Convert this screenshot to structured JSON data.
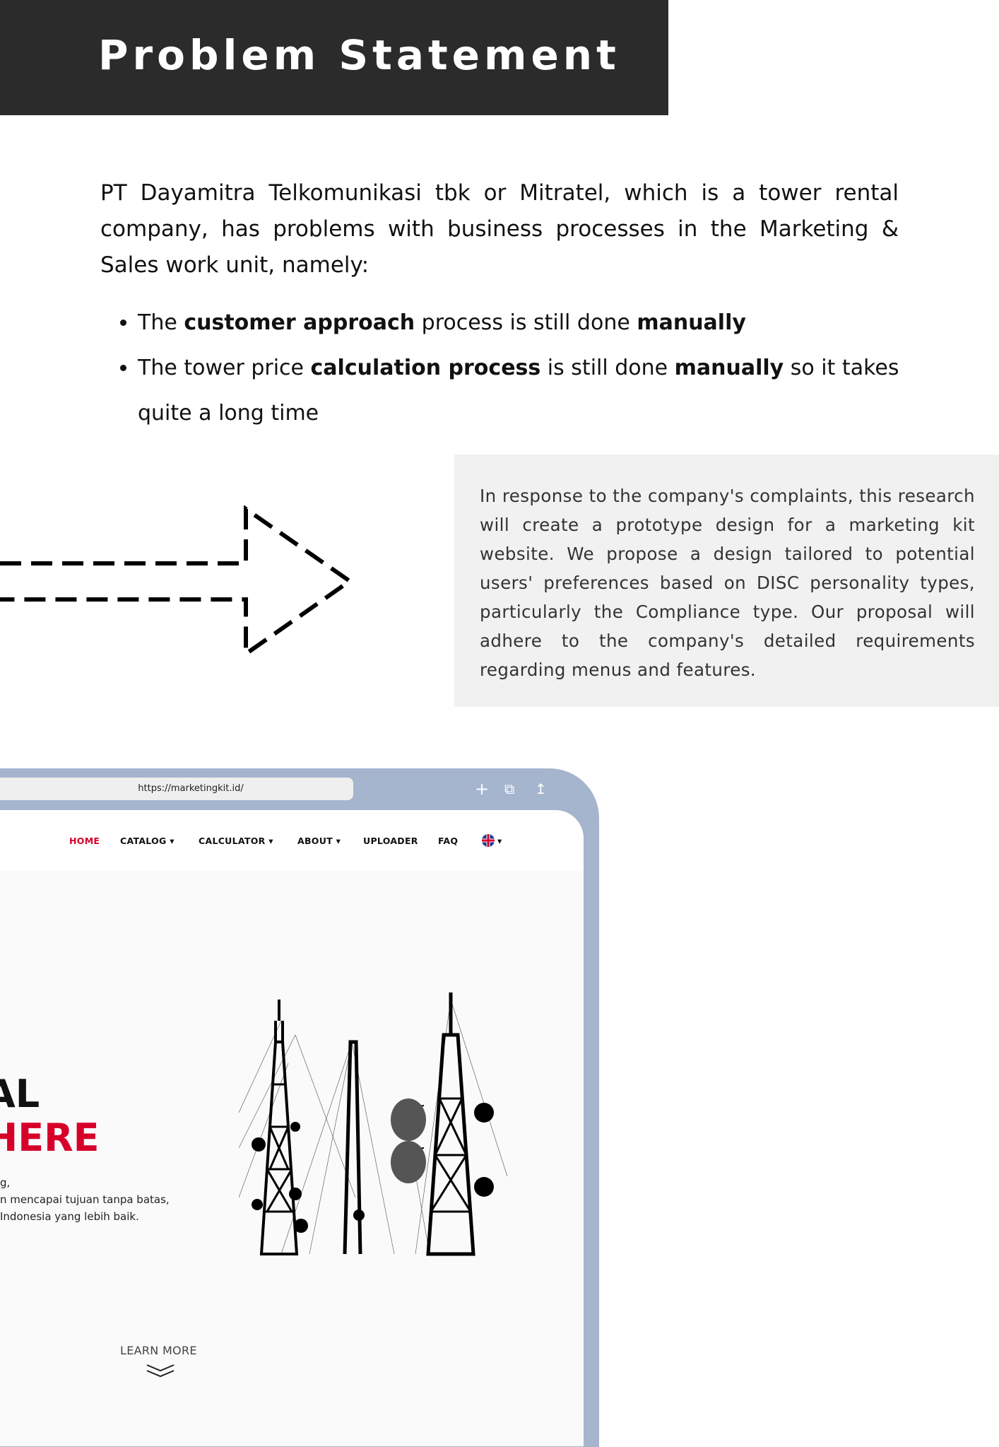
{
  "header": {
    "title": "Problem Statement"
  },
  "intro": {
    "text": "PT Dayamitra Telkomunikasi tbk or Mitratel, which is a tower rental company, has problems with business processes in the Marketing & Sales work unit, namely:"
  },
  "bullets": [
    {
      "p1": "The ",
      "b1": "customer approach",
      "p2": " process is still done ",
      "b2": "manually",
      "p3": ""
    },
    {
      "p1": "The tower price ",
      "b1": "calculation process",
      "p2": " is still done ",
      "b2": "manually",
      "p3": " so it takes quite a long time"
    }
  ],
  "response": {
    "text": "In response to the company's complaints, this research will create a prototype design for a marketing kit website. We propose a design tailored to potential users' preferences based on DISC personality types, particularly the Compliance type. Our proposal will adhere to the company's detailed requirements regarding menus and features."
  },
  "browser": {
    "url": "https://marketingkit.id/",
    "icons": [
      "plus-icon",
      "tabs-icon",
      "share-icon"
    ]
  },
  "nav": {
    "items": [
      "HOME",
      "CATALOG ▾",
      "CALCULATOR ▾",
      "ABOUT ▾",
      "UPLOADER",
      "FAQ"
    ],
    "lang": "▾"
  },
  "hero": {
    "line1": "AL",
    "line2": "HERE",
    "sub": [
      "g,",
      "n mencapai tujuan tanpa batas,",
      "Indonesia yang lebih baik."
    ],
    "learn_more": "LEARN MORE"
  },
  "colors": {
    "accent": "#d6002a",
    "frame": "#a6b5ce",
    "header": "#2b2b2b"
  }
}
